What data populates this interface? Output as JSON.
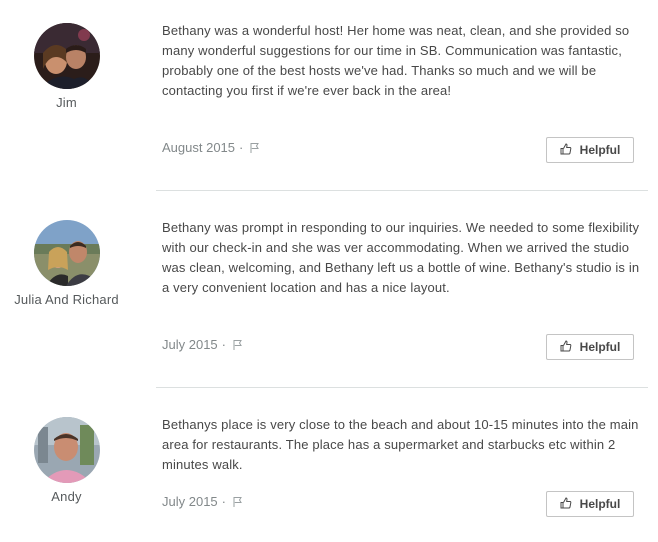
{
  "reviews": [
    {
      "name": "Jim",
      "text": "Bethany was a wonderful host! Her home was neat, clean, and she provided so many wonderful suggestions for our time in SB. Communication was fantastic, probably one of the best hosts we've had. Thanks so much and we will be contacting you first if we're ever back in the area!",
      "date": "August 2015",
      "separator": "·",
      "helpful_label": "Helpful"
    },
    {
      "name": "Julia And Richard",
      "text": "Bethany was prompt in responding to our inquiries. We needed to some flexibility with our check-in and she was ver accommodating. When we arrived the studio was clean, welcoming, and Bethany left us a bottle of wine. Bethany's studio is in a very convenient location and has a nice layout.",
      "date": "July 2015",
      "separator": "·",
      "helpful_label": "Helpful"
    },
    {
      "name": "Andy",
      "text": "Bethanys place is very close to the beach and about 10-15 minutes into the main area for restaurants. The place has a supermarket and starbucks etc within 2 minutes walk.",
      "date": "July 2015",
      "separator": "·",
      "helpful_label": "Helpful"
    }
  ],
  "icons": {
    "flag": "flag-icon",
    "thumbs_up": "thumbs-up-icon"
  }
}
